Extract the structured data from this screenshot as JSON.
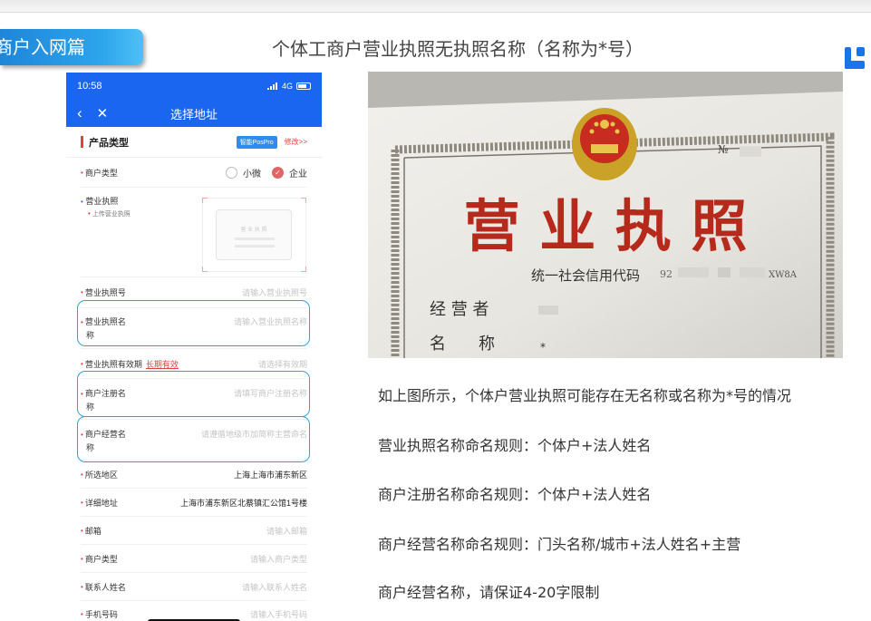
{
  "slide": {
    "section_tag": "商户入网篇",
    "title": "个体工商户营业执照无执照名称（名称为*号）",
    "brand_icon": "blue-corner-logo-icon"
  },
  "phone": {
    "status_bar": {
      "time": "10:58",
      "signal": "4G"
    },
    "nav": {
      "back_icon": "chevron-left-icon",
      "close_icon": "close-icon",
      "title": "选择地址"
    },
    "product_type": {
      "label": "产品类型",
      "badge": "智能PosPro",
      "edit": "修改>>"
    },
    "merchant_type": {
      "label": "商户类型",
      "option_micro": "小微",
      "option_enterprise": "企业",
      "selected": "企业"
    },
    "license_upload": {
      "label": "营业执照",
      "hint": "上传营业执照",
      "card_text": "营 业 执 照"
    },
    "rows": {
      "license_no": {
        "label": "营业执照号",
        "placeholder": "请输入营业执照号"
      },
      "license_name": {
        "label_1": "营业执照名",
        "label_2": "称",
        "placeholder": "请输入营业执照名称"
      },
      "license_validity": {
        "label": "营业执照有效期",
        "link": "长期有效",
        "placeholder": "请选择有效期"
      },
      "reg_name": {
        "label_1": "商户注册名",
        "label_2": "称",
        "placeholder": "请填写商户注册名称"
      },
      "biz_name": {
        "label_1": "商户经营名",
        "label_2": "称",
        "placeholder": "请遵循地级市加简称主营命名"
      },
      "region": {
        "label": "所选地区",
        "value": "上海上海市浦东新区"
      },
      "address": {
        "label": "详细地址",
        "value": "上海市浦东新区北蔡镇汇公馆1号楼"
      },
      "email": {
        "label": "邮箱",
        "placeholder": "请输入邮箱"
      },
      "merchant_category": {
        "label": "商户类型",
        "placeholder": "请输入商户类型"
      },
      "contact_name": {
        "label": "联系人姓名",
        "placeholder": "请输入联系人姓名"
      },
      "mobile": {
        "label": "手机号码",
        "placeholder": "请输入手机号码"
      }
    },
    "colors": {
      "primary": "#1b66f0",
      "required": "#e0433b",
      "highlight": "#2aa3de"
    }
  },
  "license_photo": {
    "heading": "营 业 执 照",
    "credit_code_label": "统一社会信用代码",
    "credit_code_prefix": "92",
    "credit_code_suffix": "XW8A",
    "operator_label": "经 营 者",
    "name_label": "名　　称",
    "name_value": "*",
    "serial_prefix": "№"
  },
  "notes": [
    "如上图所示，个体户营业执照可能存在无名称或名称为*号的情况",
    "营业执照名称命名规则：个体户+法人姓名",
    "商户注册名称命名规则：个体户+法人姓名",
    "商户经营名称命名规则：门头名称/城市+法人姓名+主营",
    "商户经营名称，请保证4-20字限制"
  ]
}
